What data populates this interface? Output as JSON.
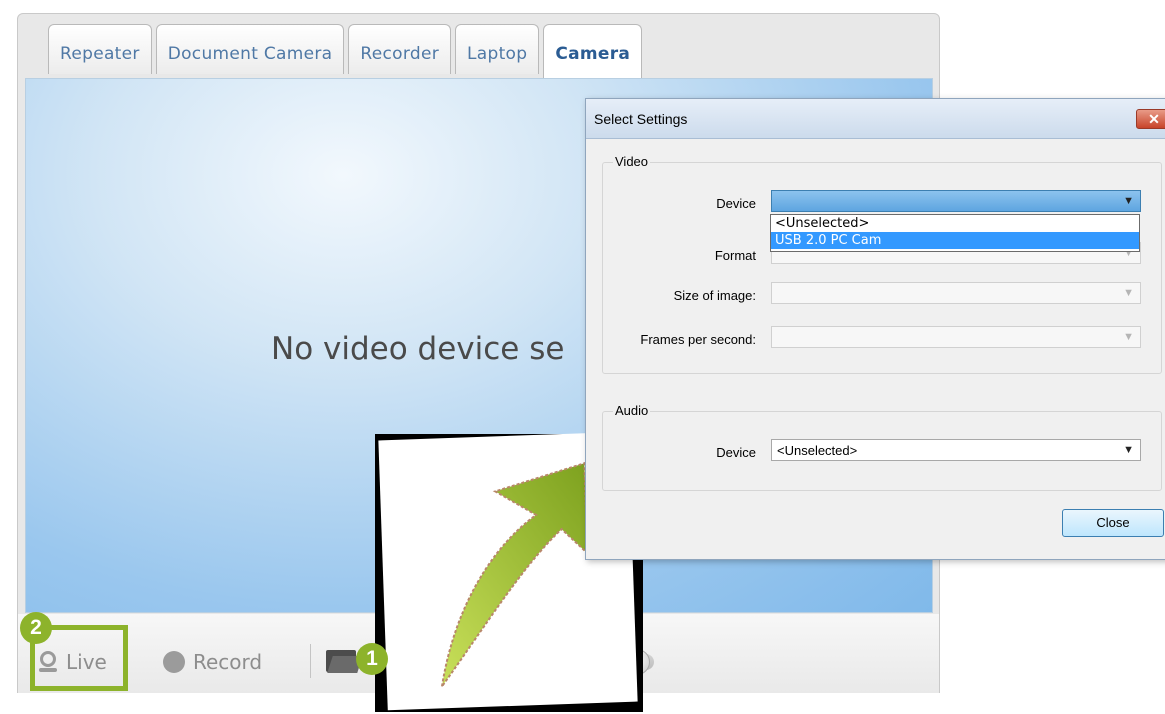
{
  "tabs": [
    "Repeater",
    "Document Camera",
    "Recorder",
    "Laptop",
    "Camera"
  ],
  "active_tab": "Camera",
  "video_area": {
    "message": "No video device se"
  },
  "toolbar": {
    "live_label": "Live",
    "record_label": "Record"
  },
  "annotations": {
    "badge_1": "1",
    "badge_2": "2",
    "accent_color": "#8db32b"
  },
  "dialog": {
    "title": "Select Settings",
    "close_glyph": "✕",
    "video_group": "Video",
    "audio_group": "Audio",
    "device_label": "Device",
    "format_label": "Format",
    "size_label": "Size of image:",
    "fps_label": "Frames per second:",
    "video_device_value": "",
    "dropdown_options": [
      "<Unselected>",
      "USB 2.0 PC Cam"
    ],
    "selected_option": "USB 2.0 PC Cam",
    "audio_device_label": "Device",
    "audio_device_value": "<Unselected>",
    "close_button": "Close"
  }
}
